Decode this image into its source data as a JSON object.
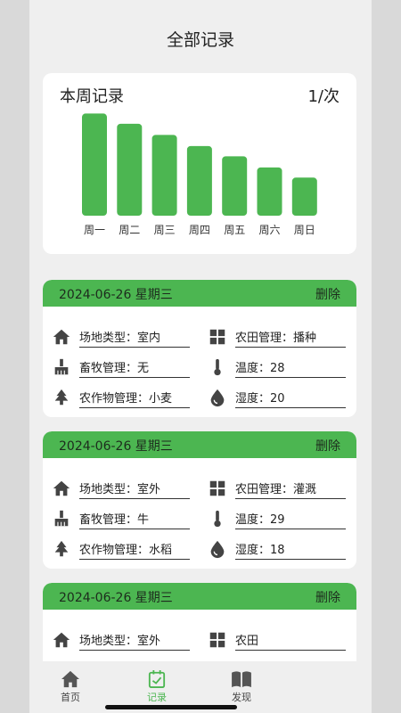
{
  "header": {
    "title": "全部记录"
  },
  "week": {
    "title": "本周记录",
    "unit": "1/次",
    "chart_data": {
      "type": "bar",
      "categories": [
        "周一",
        "周二",
        "周三",
        "周四",
        "周五",
        "周六",
        "周日"
      ],
      "values": [
        110,
        99,
        87,
        75,
        64,
        52,
        41
      ],
      "title": "",
      "xlabel": "",
      "ylabel": "",
      "ylim": [
        0,
        120
      ],
      "grid": false,
      "color": "#4cb651"
    }
  },
  "records": [
    {
      "date": "2024-06-26 星期三",
      "delete_label": "删除",
      "site": "场地类型：室内",
      "farm": "农田管理：播种",
      "livestock": "畜牧管理：无",
      "temperature": "温度：28",
      "crop": "农作物管理：小麦",
      "humidity": "湿度：20"
    },
    {
      "date": "2024-06-26 星期三",
      "delete_label": "删除",
      "site": "场地类型：室外",
      "farm": "农田管理：灌溉",
      "livestock": "畜牧管理：牛",
      "temperature": "温度：29",
      "crop": "农作物管理：水稻",
      "humidity": "湿度：18"
    },
    {
      "date": "2024-06-26 星期三",
      "delete_label": "删除",
      "site": "场地类型：室外",
      "farm": "农田"
    }
  ],
  "tabs": [
    {
      "label": "首页",
      "icon": "home-icon"
    },
    {
      "label": "记录",
      "icon": "calendar-check-icon",
      "active": true
    },
    {
      "label": "发现",
      "icon": "book-icon"
    }
  ],
  "colors": {
    "accent": "#4cb651",
    "background": "#efefef",
    "card": "#ffffff"
  }
}
